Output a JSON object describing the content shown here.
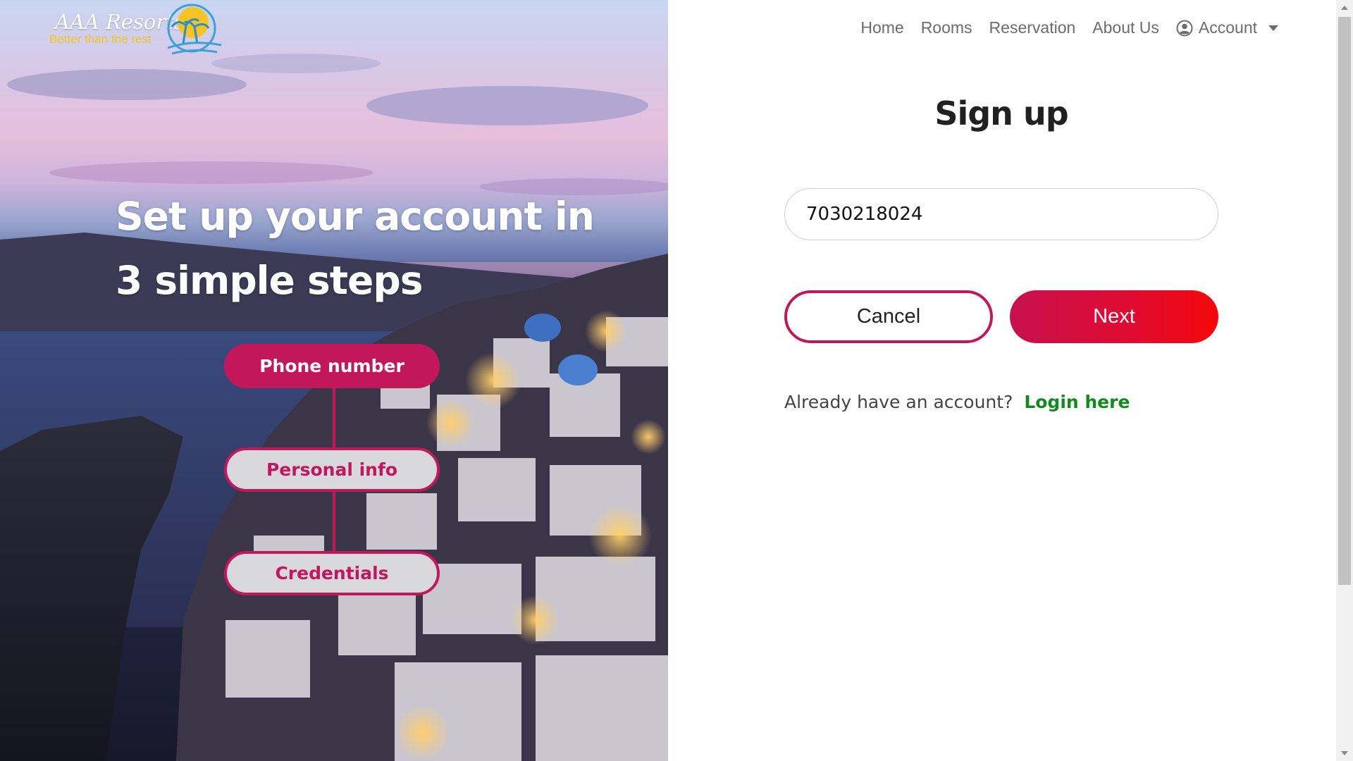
{
  "brand": {
    "name": "AAA Resorts",
    "tagline": "Better than the rest"
  },
  "nav": {
    "items": [
      {
        "label": "Home"
      },
      {
        "label": "Rooms"
      },
      {
        "label": "Reservation"
      },
      {
        "label": "About Us"
      }
    ],
    "account_label": "Account",
    "account_icon": "user-circle-icon"
  },
  "hero": {
    "heading_line1": "Set up your account in",
    "heading_line2": "3 simple steps",
    "steps": [
      {
        "label": "Phone number",
        "active": true
      },
      {
        "label": "Personal info",
        "active": false
      },
      {
        "label": "Credentials",
        "active": false
      }
    ]
  },
  "form": {
    "title": "Sign up",
    "phone_value": "7030218024",
    "cancel_label": "Cancel",
    "next_label": "Next",
    "login_prompt": "Already have an account?",
    "login_link": "Login here"
  },
  "colors": {
    "accent": "#c2185b",
    "next_gradient_end": "#f5070b",
    "link_green": "#138a1f"
  }
}
